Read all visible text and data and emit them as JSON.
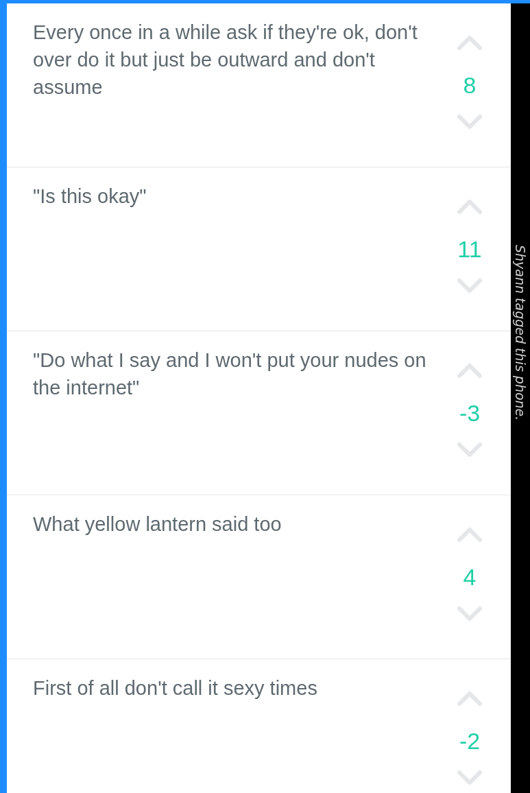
{
  "comments": [
    {
      "text": "Every once in a while ask if they're ok, don't over do it but just be outward and don't assume",
      "score": "8"
    },
    {
      "text": "\"Is this okay\"",
      "score": "11"
    },
    {
      "text": "\"Do what I say and I won't put your nudes on the internet\"",
      "score": "-3"
    },
    {
      "text": "What yellow lantern said too",
      "score": "4"
    },
    {
      "text": "First of all don't call it sexy times",
      "score": "-2"
    }
  ],
  "side_note": "Shyann tagged this phone."
}
